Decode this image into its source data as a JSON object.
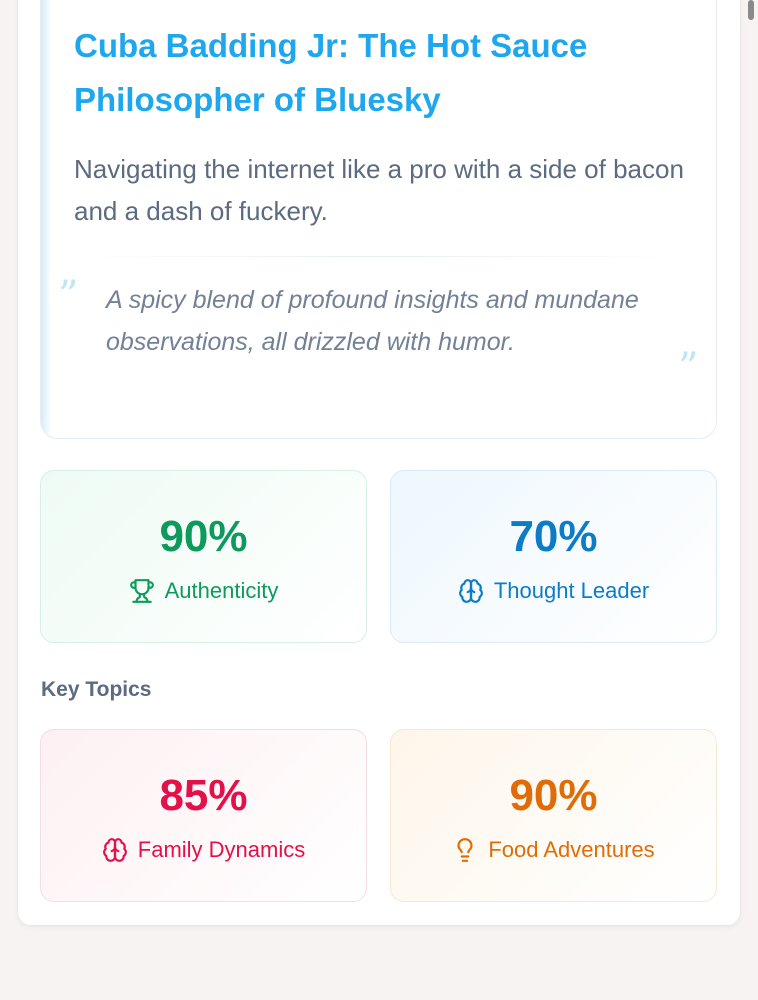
{
  "profile": {
    "title": "Cuba Badding Jr: The Hot Sauce Philosopher of Bluesky",
    "tagline": "Navigating the internet like a pro with a side of bacon and a dash of fuckery.",
    "quote": "A spicy blend of profound insights and mundane observations, all drizzled with humor.",
    "quote_open": "”",
    "quote_close": "”"
  },
  "stats": [
    {
      "value": "90%",
      "label": "Authenticity",
      "icon": "trophy-icon",
      "color": "#0e9a5c"
    },
    {
      "value": "70%",
      "label": "Thought Leader",
      "icon": "brain-icon",
      "color": "#0c7cc6"
    }
  ],
  "key_topics": {
    "heading": "Key Topics",
    "items": [
      {
        "value": "85%",
        "label": "Family Dynamics",
        "icon": "brain-icon",
        "color": "#e3104a"
      },
      {
        "value": "90%",
        "label": "Food Adventures",
        "icon": "lightbulb-icon",
        "color": "#e06c07"
      }
    ]
  }
}
